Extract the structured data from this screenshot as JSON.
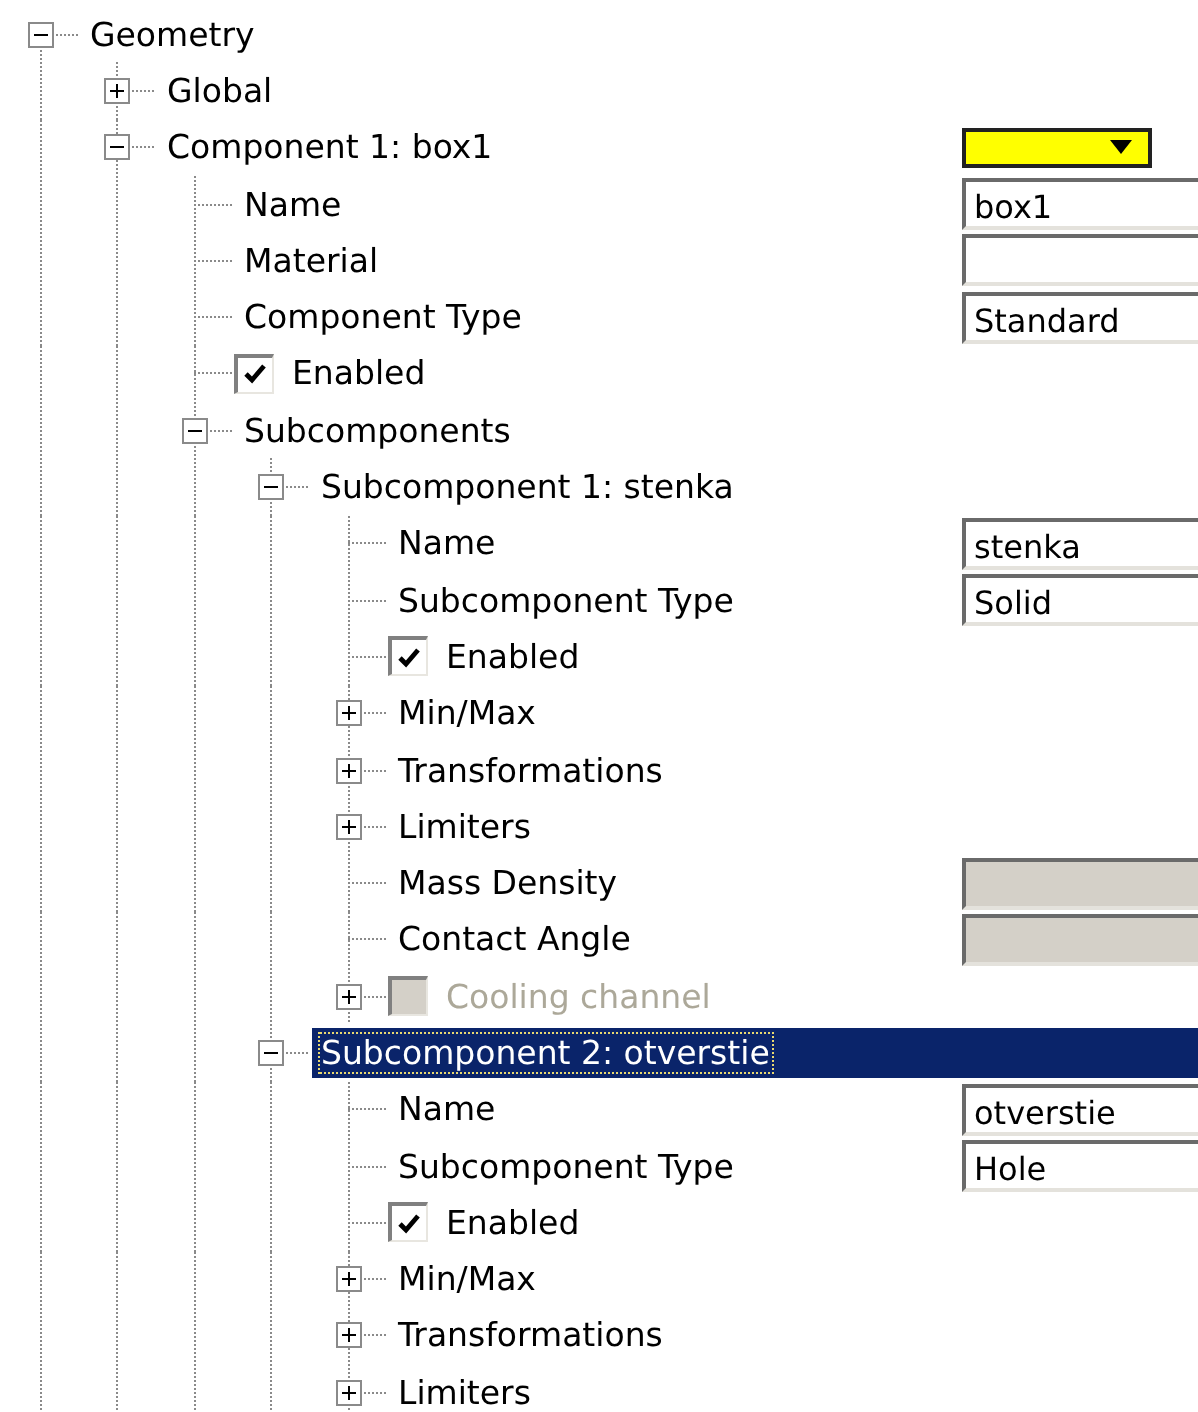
{
  "tree": [
    {
      "label": "Geometry",
      "kind": "group",
      "expanded": true,
      "selected": false,
      "children": [
        {
          "label": "Global",
          "kind": "group",
          "expanded": false,
          "selected": false
        },
        {
          "label": "Component 1: box1",
          "kind": "group",
          "expanded": true,
          "selected": false,
          "field": {
            "kind": "color",
            "color": "#ffff00"
          },
          "children": [
            {
              "label": "Name",
              "kind": "property",
              "selected": false,
              "field": {
                "kind": "text",
                "value": "box1"
              }
            },
            {
              "label": "Material",
              "kind": "property",
              "selected": false,
              "field": {
                "kind": "text"
              }
            },
            {
              "label": "Component Type",
              "kind": "property",
              "selected": false,
              "field": {
                "kind": "text",
                "value": "Standard"
              }
            },
            {
              "label": "Enabled",
              "kind": "checkbox",
              "checked": true,
              "selected": false
            },
            {
              "label": "Subcomponents",
              "kind": "group",
              "expanded": true,
              "selected": false,
              "children": [
                {
                  "label": "Subcomponent 1: stenka",
                  "kind": "group",
                  "expanded": true,
                  "selected": false,
                  "children": [
                    {
                      "label": "Name",
                      "kind": "property",
                      "selected": false,
                      "field": {
                        "kind": "text",
                        "value": "stenka"
                      }
                    },
                    {
                      "label": "Subcomponent Type",
                      "kind": "property",
                      "selected": false,
                      "field": {
                        "kind": "text",
                        "value": "Solid"
                      }
                    },
                    {
                      "label": "Enabled",
                      "kind": "checkbox",
                      "checked": true,
                      "selected": false
                    },
                    {
                      "label": "Min/Max",
                      "kind": "group",
                      "expanded": false,
                      "selected": false
                    },
                    {
                      "label": "Transformations",
                      "kind": "group",
                      "expanded": false,
                      "selected": false
                    },
                    {
                      "label": "Limiters",
                      "kind": "group",
                      "expanded": false,
                      "selected": false
                    },
                    {
                      "label": "Mass Density",
                      "kind": "property",
                      "selected": false,
                      "field": {
                        "kind": "text",
                        "disabled": true
                      }
                    },
                    {
                      "label": "Contact Angle",
                      "kind": "property",
                      "selected": false,
                      "field": {
                        "kind": "text",
                        "disabled": true
                      }
                    },
                    {
                      "label": "Cooling channel",
                      "kind": "checkbox",
                      "expanded": false,
                      "checked": false,
                      "disabled": true,
                      "selected": false
                    }
                  ]
                },
                {
                  "label": "Subcomponent 2: otverstie",
                  "kind": "group",
                  "expanded": true,
                  "selected": true,
                  "children": [
                    {
                      "label": "Name",
                      "kind": "property",
                      "selected": false,
                      "field": {
                        "kind": "text",
                        "value": "otverstie"
                      }
                    },
                    {
                      "label": "Subcomponent Type",
                      "kind": "property",
                      "selected": false,
                      "field": {
                        "kind": "text",
                        "value": "Hole"
                      }
                    },
                    {
                      "label": "Enabled",
                      "kind": "checkbox",
                      "checked": true,
                      "selected": false
                    },
                    {
                      "label": "Min/Max",
                      "kind": "group",
                      "expanded": false,
                      "selected": false
                    },
                    {
                      "label": "Transformations",
                      "kind": "group",
                      "expanded": false,
                      "selected": false
                    },
                    {
                      "label": "Limiters",
                      "kind": "group",
                      "expanded": false,
                      "selected": false
                    }
                  ]
                }
              ]
            }
          ]
        }
      ]
    }
  ]
}
